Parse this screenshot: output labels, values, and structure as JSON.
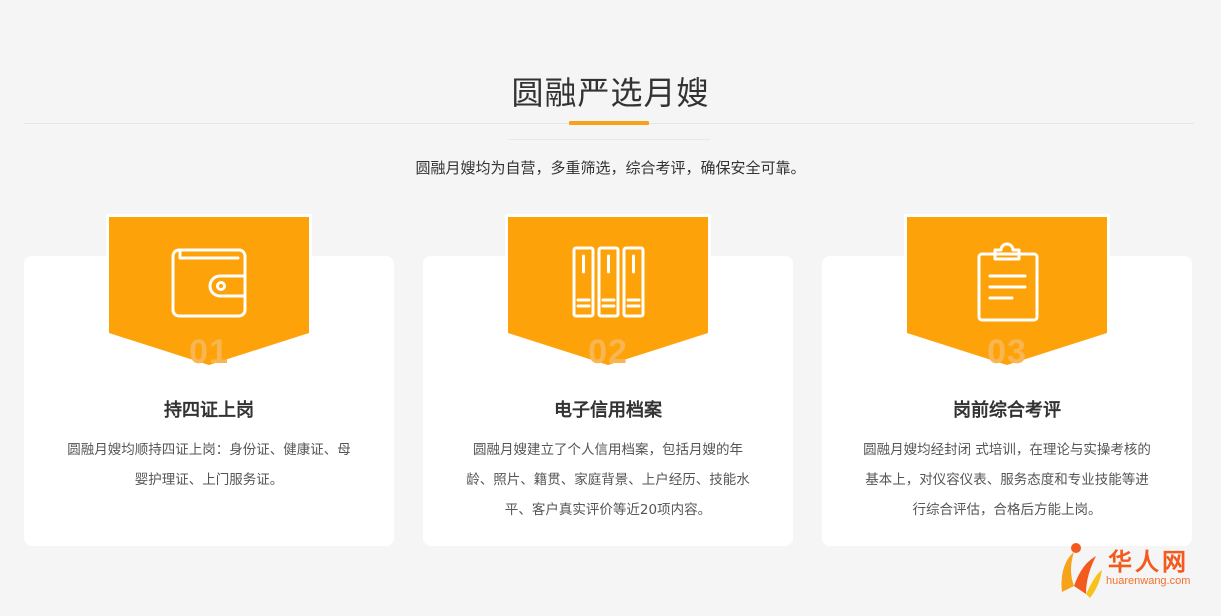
{
  "header": {
    "title": "圆融严选月嫂",
    "subtitle": "圆融月嫂均为自营，多重筛选，综合考评，确保安全可靠。"
  },
  "colors": {
    "accent": "#f7a21b",
    "badge": "#fea20a",
    "card_bg": "#ffffff",
    "page_bg": "#f5f5f5"
  },
  "cards": [
    {
      "number": "01",
      "icon": "wallet-icon",
      "title": "持四证上岗",
      "desc": "圆融月嫂均顺持四证上岗：身份证、健康证、母婴护理证、上门服务证。"
    },
    {
      "number": "02",
      "icon": "binders-icon",
      "title": "电子信用档案",
      "desc": "圆融月嫂建立了个人信用档案，包括月嫂的年龄、照片、籍贯、家庭背景、上户经历、技能水平、客户真实评价等近20项内容。"
    },
    {
      "number": "03",
      "icon": "clipboard-icon",
      "title": "岗前综合考评",
      "desc": "圆融月嫂均经封闭 式培训，在理论与实操考核的基本上，对仪容仪表、服务态度和专业技能等进行综合评估，合格后方能上岗。"
    }
  ],
  "watermark": {
    "brand": "华人网",
    "url": "huarenwang.com"
  }
}
